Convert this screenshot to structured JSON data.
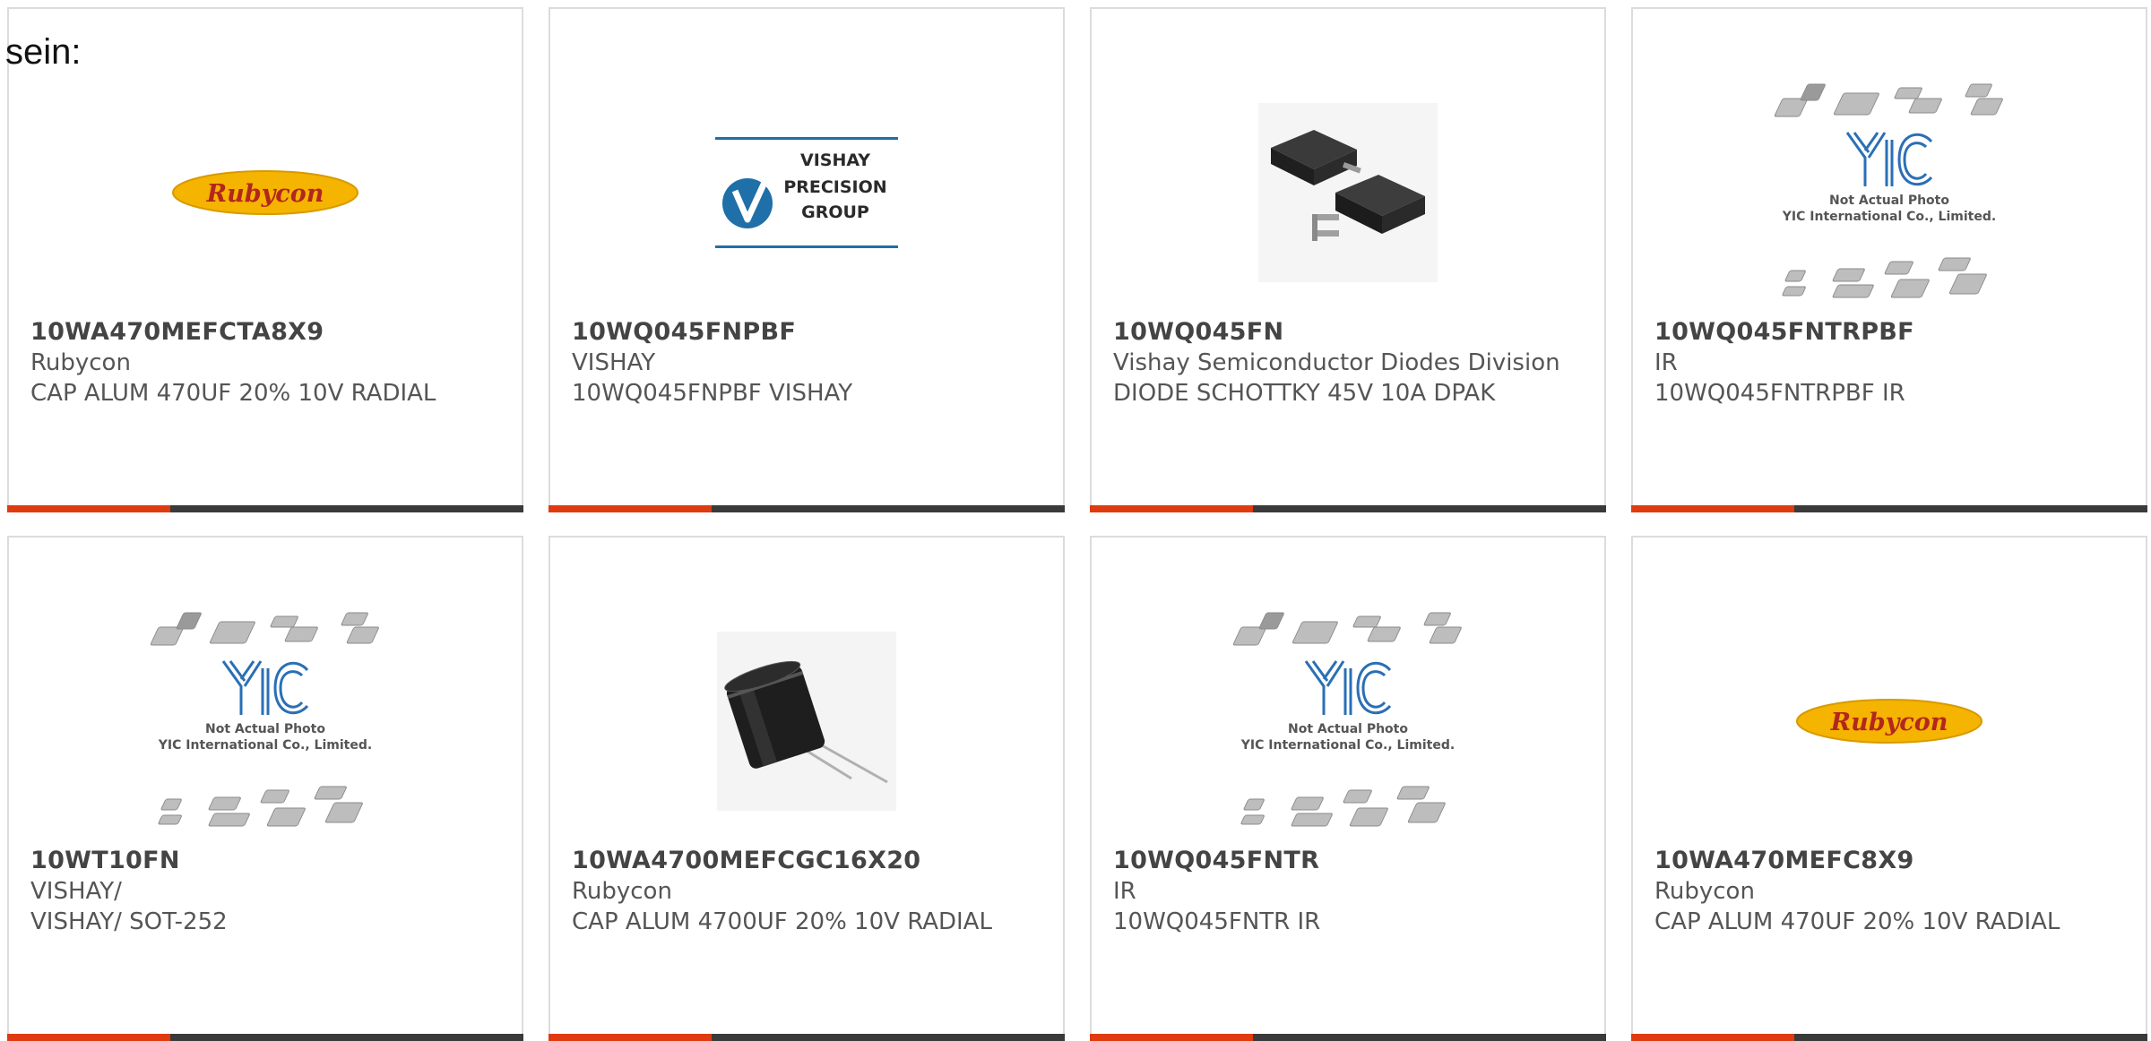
{
  "page_label": "sein:",
  "colors": {
    "accent": "#e03a10",
    "bar": "#3a3a3a",
    "border": "#dcdcdc",
    "part_text": "#444444",
    "body_text": "#555555",
    "yic_blue": "#2a6fb5",
    "rubycon_yellow": "#f4b400",
    "rubycon_red": "#b3261e",
    "vishay_blue": "#1f6fa8"
  },
  "products": [
    {
      "part_number": "10WA470MEFCTA8X9",
      "manufacturer": "Rubycon",
      "description": "CAP ALUM 470UF 20% 10V RADIAL",
      "image": "rubycon-logo",
      "logo_text": "Rubycon"
    },
    {
      "part_number": "10WQ045FNPBF",
      "manufacturer": "VISHAY",
      "description": "10WQ045FNPBF VISHAY",
      "image": "vishay-precision-logo",
      "logo_lines": [
        "VISHAY",
        "PRECISION",
        "GROUP"
      ]
    },
    {
      "part_number": "10WQ045FN",
      "manufacturer": "Vishay Semiconductor Diodes Division",
      "description": "DIODE SCHOTTKY 45V 10A DPAK",
      "image": "dpak-photo"
    },
    {
      "part_number": "10WQ045FNTRPBF",
      "manufacturer": "IR",
      "description": "10WQ045FNTRPBF IR",
      "image": "yic-placeholder",
      "placeholder_lines": [
        "Not Actual Photo",
        "YIC International Co., Limited."
      ]
    },
    {
      "part_number": "10WT10FN",
      "manufacturer": "VISHAY/",
      "description": "VISHAY/ SOT-252",
      "image": "yic-placeholder",
      "placeholder_lines": [
        "Not Actual Photo",
        "YIC International Co., Limited."
      ]
    },
    {
      "part_number": "10WA4700MEFCGC16X20",
      "manufacturer": "Rubycon",
      "description": "CAP ALUM 4700UF 20% 10V RADIAL",
      "image": "capacitor-photo"
    },
    {
      "part_number": "10WQ045FNTR",
      "manufacturer": "IR",
      "description": "10WQ045FNTR IR",
      "image": "yic-placeholder",
      "placeholder_lines": [
        "Not Actual Photo",
        "YIC International Co., Limited."
      ]
    },
    {
      "part_number": "10WA470MEFC8X9",
      "manufacturer": "Rubycon",
      "description": "CAP ALUM 470UF 20% 10V RADIAL",
      "image": "rubycon-logo",
      "logo_text": "Rubycon"
    }
  ]
}
